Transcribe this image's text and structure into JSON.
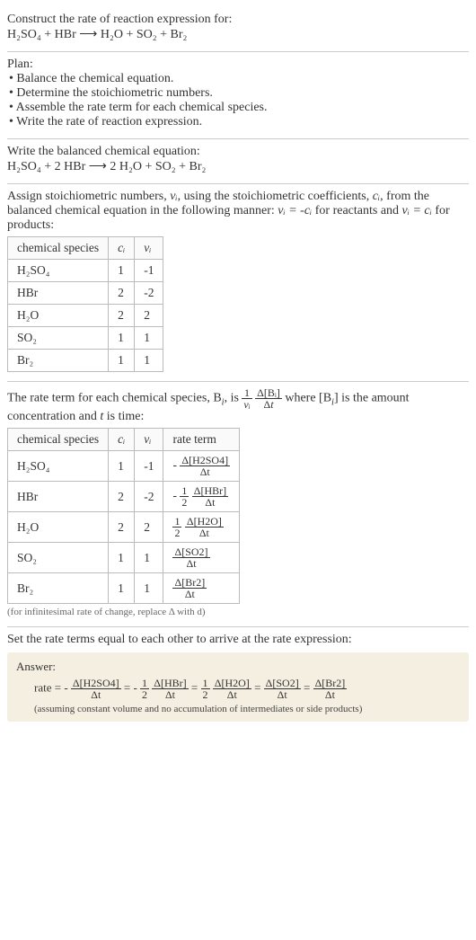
{
  "intro": {
    "title": "Construct the rate of reaction expression for:",
    "equation": "H₂SO₄ + HBr ⟶ H₂O + SO₂ + Br₂"
  },
  "plan": {
    "heading": "Plan:",
    "items": [
      "• Balance the chemical equation.",
      "• Determine the stoichiometric numbers.",
      "• Assemble the rate term for each chemical species.",
      "• Write the rate of reaction expression."
    ]
  },
  "balanced": {
    "heading": "Write the balanced chemical equation:",
    "equation": "H₂SO₄ + 2 HBr ⟶ 2 H₂O + SO₂ + Br₂"
  },
  "assign": {
    "text_pre": "Assign stoichiometric numbers, ",
    "nu": "νᵢ",
    "text_mid1": ", using the stoichiometric coefficients, ",
    "ci": "cᵢ",
    "text_mid2": ", from the balanced chemical equation in the following manner: ",
    "rule1": "νᵢ = -cᵢ",
    "text_mid3": " for reactants and ",
    "rule2": "νᵢ = cᵢ",
    "text_end": " for products:",
    "headers": [
      "chemical species",
      "cᵢ",
      "νᵢ"
    ],
    "rows": [
      [
        "H₂SO₄",
        "1",
        "-1"
      ],
      [
        "HBr",
        "2",
        "-2"
      ],
      [
        "H₂O",
        "2",
        "2"
      ],
      [
        "SO₂",
        "1",
        "1"
      ],
      [
        "Br₂",
        "1",
        "1"
      ]
    ]
  },
  "rateterm": {
    "text1": "The rate term for each chemical species, B",
    "text2": ", is ",
    "text3": " where [B",
    "text4": "] is the amount concentration and ",
    "tvar": "t",
    "text5": " is time:",
    "headers": [
      "chemical species",
      "cᵢ",
      "νᵢ",
      "rate term"
    ],
    "rows": [
      {
        "sp": "H₂SO₄",
        "c": "1",
        "nu": "-1",
        "num": "Δ[H2SO4]",
        "den": "Δt",
        "coef": "-"
      },
      {
        "sp": "HBr",
        "c": "2",
        "nu": "-2",
        "num": "Δ[HBr]",
        "den": "Δt",
        "coef": "-½"
      },
      {
        "sp": "H₂O",
        "c": "2",
        "nu": "2",
        "num": "Δ[H2O]",
        "den": "Δt",
        "coef": "½"
      },
      {
        "sp": "SO₂",
        "c": "1",
        "nu": "1",
        "num": "Δ[SO2]",
        "den": "Δt",
        "coef": ""
      },
      {
        "sp": "Br₂",
        "c": "1",
        "nu": "1",
        "num": "Δ[Br2]",
        "den": "Δt",
        "coef": ""
      }
    ],
    "note": "(for infinitesimal rate of change, replace Δ with d)"
  },
  "final": {
    "heading": "Set the rate terms equal to each other to arrive at the rate expression:",
    "answer_label": "Answer:",
    "rate_eq": "rate = -Δ[H2SO4]/Δt = -½ Δ[HBr]/Δt = ½ Δ[H2O]/Δt = Δ[SO2]/Δt = Δ[Br2]/Δt",
    "assume": "(assuming constant volume and no accumulation of intermediates or side products)"
  }
}
